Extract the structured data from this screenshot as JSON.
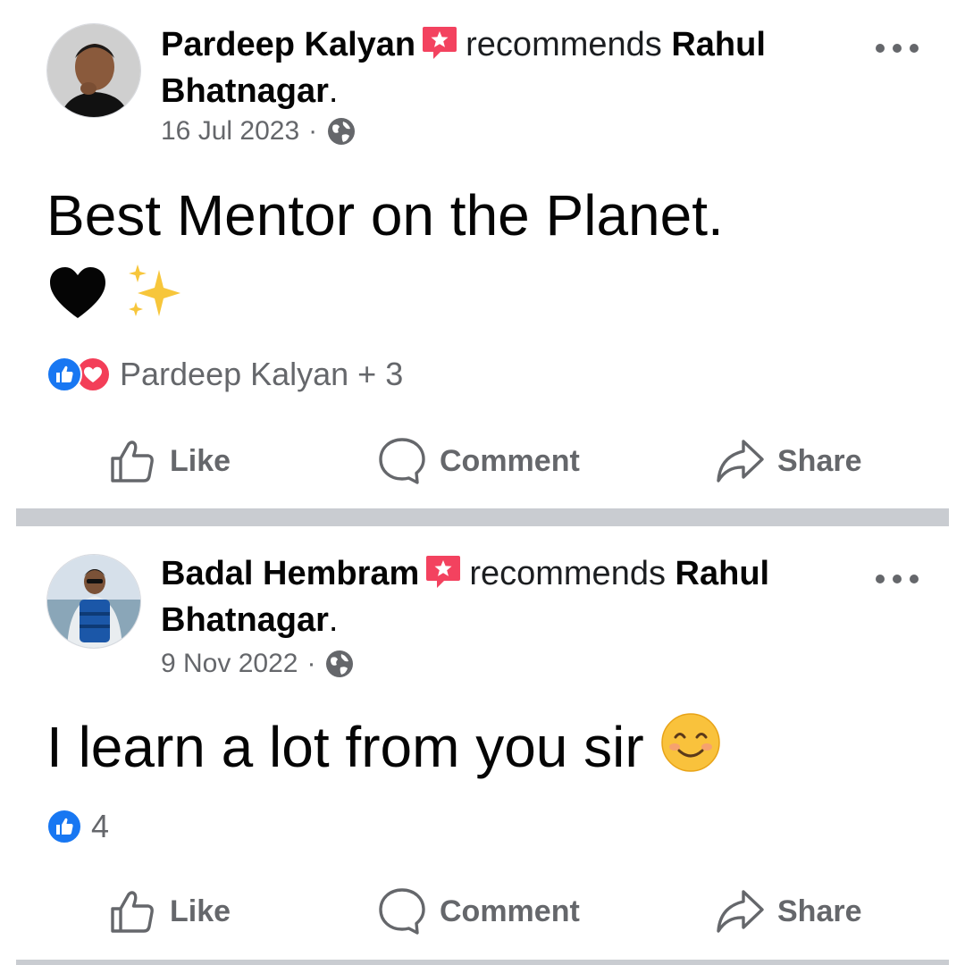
{
  "posts": [
    {
      "author": "Pardeep Kalyan",
      "action_text": "recommends",
      "subject": "Rahul Bhatnagar",
      "subject_suffix": ".",
      "date": "16 Jul 2023",
      "separator": "·",
      "audience_icon": "globe-icon",
      "body": "Best Mentor on the Planet.",
      "body_emojis": [
        "🖤",
        "✨"
      ],
      "reactions_text": "Pardeep Kalyan + 3",
      "reaction_types": [
        "like",
        "love"
      ]
    },
    {
      "author": "Badal Hembram",
      "action_text": "recommends",
      "subject": "Rahul Bhatnagar",
      "subject_suffix": ".",
      "date": "9 Nov 2022",
      "separator": "·",
      "audience_icon": "globe-icon",
      "body": "I learn a lot from you sir",
      "body_emojis": [
        "😊"
      ],
      "reactions_text": "4",
      "reaction_types": [
        "like"
      ]
    }
  ],
  "actions": {
    "like": "Like",
    "comment": "Comment",
    "share": "Share"
  },
  "colors": {
    "like_blue": "#1877f2",
    "love_red": "#f33e58",
    "recommend_badge": "#f3425f",
    "secondary_text": "#65676b",
    "divider": "#c9ccd1"
  }
}
